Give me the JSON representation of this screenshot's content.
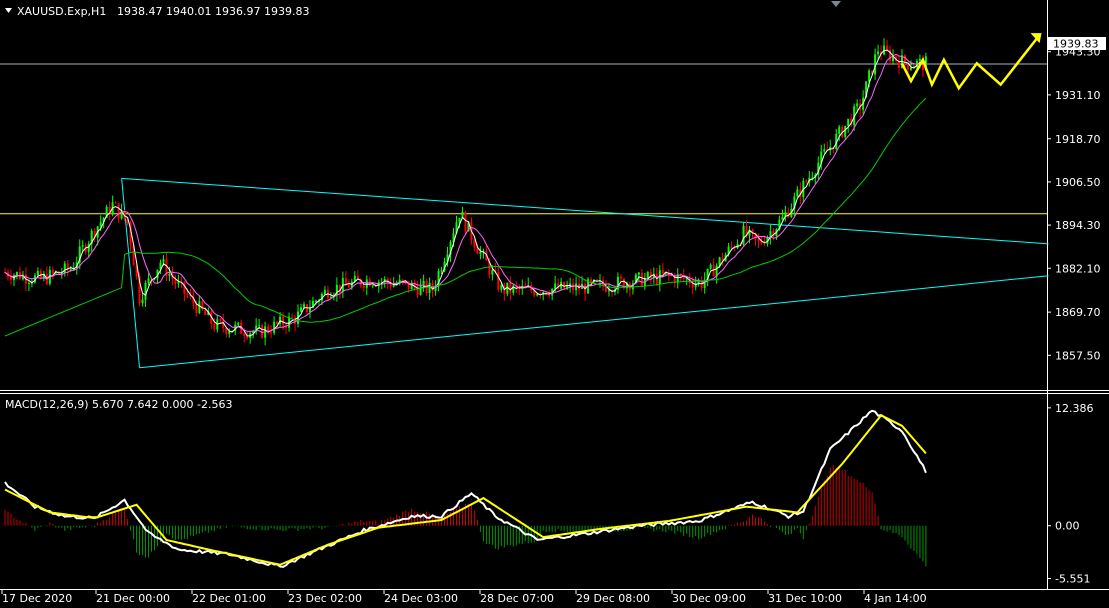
{
  "header": {
    "symbol": "XAUUSD.Exp,H1",
    "ohlc": "1938.47 1940.01 1936.97 1939.83"
  },
  "macd_header": "MACD(12,26,9) 5.670 7.642 0.000 -2.563",
  "current_price_label": "1939.83",
  "colors": {
    "background": "#000000",
    "axis": "#ffffff",
    "bull_candle": "#00ff00",
    "bear_candle": "#ff0000",
    "trendline": "#00ffff",
    "horizontal_level": "#ffff00",
    "ma_fast": "#ffffff",
    "ma_mid": "#ff66ff",
    "ma_slow": "#00cc00",
    "macd_line": "#ffffff",
    "signal_line": "#ffff00",
    "hist_pos": "#cc0000",
    "hist_neg": "#009900",
    "projection": "#ffff00"
  },
  "chart_data": [
    {
      "type": "candlestick",
      "symbol": "XAUUSD.Exp",
      "timeframe": "H1",
      "y_ticks": [
        "1943.30",
        "1931.10",
        "1918.70",
        "1906.50",
        "1894.30",
        "1882.10",
        "1869.70",
        "1857.50"
      ],
      "ylim": [
        1852.5,
        1950.0
      ],
      "x_ticks": [
        "17 Dec 2020",
        "21 Dec 00:00",
        "22 Dec 01:00",
        "23 Dec 02:00",
        "24 Dec 03:00",
        "28 Dec 07:00",
        "29 Dec 08:00",
        "30 Dec 09:00",
        "31 Dec 10:00",
        "4 Jan 14:00"
      ],
      "horizontal_levels": [
        1939.83,
        1897.5
      ],
      "price_path": [
        {
          "bar": 0,
          "price": 1881
        },
        {
          "bar": 12,
          "price": 1879
        },
        {
          "bar": 22,
          "price": 1882
        },
        {
          "bar": 30,
          "price": 1893
        },
        {
          "bar": 36,
          "price": 1900
        },
        {
          "bar": 41,
          "price": 1895
        },
        {
          "bar": 45,
          "price": 1874
        },
        {
          "bar": 52,
          "price": 1884
        },
        {
          "bar": 58,
          "price": 1877
        },
        {
          "bar": 70,
          "price": 1866
        },
        {
          "bar": 85,
          "price": 1864
        },
        {
          "bar": 97,
          "price": 1868
        },
        {
          "bar": 108,
          "price": 1876
        },
        {
          "bar": 122,
          "price": 1879
        },
        {
          "bar": 143,
          "price": 1876
        },
        {
          "bar": 152,
          "price": 1898
        },
        {
          "bar": 158,
          "price": 1888
        },
        {
          "bar": 166,
          "price": 1876
        },
        {
          "bar": 178,
          "price": 1876
        },
        {
          "bar": 198,
          "price": 1877
        },
        {
          "bar": 222,
          "price": 1880
        },
        {
          "bar": 233,
          "price": 1878
        },
        {
          "bar": 247,
          "price": 1892
        },
        {
          "bar": 252,
          "price": 1889
        },
        {
          "bar": 260,
          "price": 1896
        },
        {
          "bar": 272,
          "price": 1912
        },
        {
          "bar": 286,
          "price": 1928
        },
        {
          "bar": 292,
          "price": 1944
        },
        {
          "bar": 301,
          "price": 1940
        },
        {
          "bar": 308,
          "price": 1939.83
        }
      ],
      "trendlines": [
        {
          "from": {
            "bar": 39,
            "price": 1907.5
          },
          "to": {
            "bar": 349,
            "price": 1889
          }
        },
        {
          "from": {
            "bar": 45,
            "price": 1854
          },
          "to": {
            "bar": 349,
            "price": 1880
          }
        },
        {
          "from": {
            "bar": 39,
            "price": 1907.5
          },
          "to": {
            "bar": 45,
            "price": 1854
          }
        }
      ],
      "moving_averages": [
        {
          "name": "fast",
          "color": "#ffffff",
          "period_bars": 3
        },
        {
          "name": "mid",
          "color": "#ff66ff",
          "period_bars": 8
        },
        {
          "name": "slow",
          "color": "#00cc00",
          "period_bars": 40
        }
      ],
      "projection": [
        {
          "bar": 300,
          "price": 1940
        },
        {
          "bar": 303,
          "price": 1935
        },
        {
          "bar": 307,
          "price": 1941
        },
        {
          "bar": 310,
          "price": 1934
        },
        {
          "bar": 314,
          "price": 1941
        },
        {
          "bar": 319,
          "price": 1933
        },
        {
          "bar": 325,
          "price": 1940
        },
        {
          "bar": 333,
          "price": 1934
        },
        {
          "bar": 346,
          "price": 1948
        }
      ]
    },
    {
      "type": "macd",
      "title": "MACD(12,26,9) 5.670 7.642 0.000 -2.563",
      "y_ticks": [
        "12.386",
        "0.00",
        "-5.551"
      ],
      "ylim": [
        -5.6,
        13.0
      ],
      "macd_path": [
        {
          "bar": 0,
          "value": 4.5
        },
        {
          "bar": 10,
          "value": 2.0
        },
        {
          "bar": 20,
          "value": 1.0
        },
        {
          "bar": 30,
          "value": 0.8
        },
        {
          "bar": 40,
          "value": 2.7
        },
        {
          "bar": 48,
          "value": -0.8
        },
        {
          "bar": 58,
          "value": -2.5
        },
        {
          "bar": 75,
          "value": -3.0
        },
        {
          "bar": 92,
          "value": -4.3
        },
        {
          "bar": 105,
          "value": -2.5
        },
        {
          "bar": 120,
          "value": -0.5
        },
        {
          "bar": 136,
          "value": 1.0
        },
        {
          "bar": 146,
          "value": 1.0
        },
        {
          "bar": 156,
          "value": 3.4
        },
        {
          "bar": 164,
          "value": 1.0
        },
        {
          "bar": 178,
          "value": -1.5
        },
        {
          "bar": 195,
          "value": -0.8
        },
        {
          "bar": 212,
          "value": 0
        },
        {
          "bar": 232,
          "value": 0.5
        },
        {
          "bar": 250,
          "value": 2.5
        },
        {
          "bar": 262,
          "value": 1.0
        },
        {
          "bar": 267,
          "value": 1.5
        },
        {
          "bar": 276,
          "value": 8.0
        },
        {
          "bar": 290,
          "value": 12.1
        },
        {
          "bar": 300,
          "value": 10.0
        },
        {
          "bar": 308,
          "value": 5.7
        }
      ],
      "signal_path": [
        {
          "bar": 0,
          "value": 3.8
        },
        {
          "bar": 15,
          "value": 1.4
        },
        {
          "bar": 30,
          "value": 0.8
        },
        {
          "bar": 44,
          "value": 2.2
        },
        {
          "bar": 54,
          "value": -1.5
        },
        {
          "bar": 68,
          "value": -2.5
        },
        {
          "bar": 92,
          "value": -4.1
        },
        {
          "bar": 108,
          "value": -2.0
        },
        {
          "bar": 125,
          "value": -0.2
        },
        {
          "bar": 146,
          "value": 0.6
        },
        {
          "bar": 160,
          "value": 2.9
        },
        {
          "bar": 180,
          "value": -1.2
        },
        {
          "bar": 200,
          "value": -0.3
        },
        {
          "bar": 222,
          "value": 0.5
        },
        {
          "bar": 248,
          "value": 2.0
        },
        {
          "bar": 265,
          "value": 1.4
        },
        {
          "bar": 280,
          "value": 6.5
        },
        {
          "bar": 293,
          "value": 11.6
        },
        {
          "bar": 300,
          "value": 10.5
        },
        {
          "bar": 308,
          "value": 7.6
        }
      ]
    }
  ]
}
